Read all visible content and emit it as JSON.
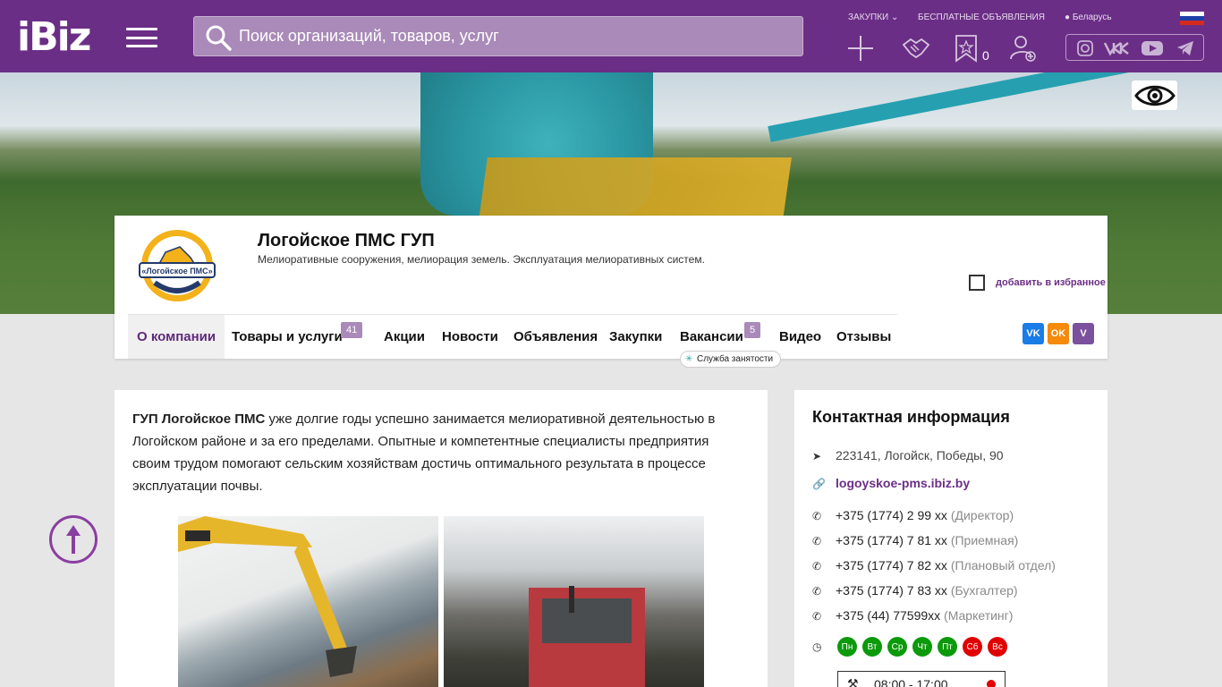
{
  "header": {
    "logo_text": "iBiz",
    "search_placeholder": "Поиск организаций, товаров, услуг",
    "links": {
      "purchases": "ЗАКУПКИ",
      "free_ads": "БЕСПЛАТНЫЕ ОБЪЯВЛЕНИЯ",
      "region": "Беларусь"
    },
    "favorites_count": "0",
    "brand_color": "#6b2e86"
  },
  "company": {
    "name": "Логойское ПМС ГУП",
    "description": "Мелиоративные сооружения, мелиорация земель. Эксплуатация мелиоративных систем.",
    "add_favorite": "добавить в избранное",
    "logo_text": "«Логойское ПМС»"
  },
  "tabs": [
    {
      "label": "О компании"
    },
    {
      "label": "Товары и услуги",
      "badge": "41"
    },
    {
      "label": "Акции"
    },
    {
      "label": "Новости"
    },
    {
      "label": "Объявления"
    },
    {
      "label": "Закупки"
    },
    {
      "label": "Вакансии",
      "badge": "5"
    },
    {
      "label": "Видео"
    },
    {
      "label": "Отзывы"
    }
  ],
  "employment_tip": "Служба занятости",
  "share": {
    "vk": "VK",
    "ok": "OK",
    "viber": "V"
  },
  "about": {
    "lead": "ГУП Логойское ПМС",
    "text": " уже долгие годы успешно занимается мелиоративной деятельностью в Логойском районе и за его пределами. Опытные и компетентные специалисты предприятия своим трудом помогают сельским хозяйствам достичь оптимального результата в процессе эксплуатации почвы."
  },
  "contacts": {
    "title": "Контактная информация",
    "address": "223141, Логойск, Победы, 90",
    "site": "logoyskoe-pms.ibiz.by",
    "phones": [
      {
        "number": "+375 (1774) 2 99 xx",
        "note": "(Директор)"
      },
      {
        "number": "+375 (1774) 7 81 xx",
        "note": "(Приемная)"
      },
      {
        "number": "+375 (1774) 7 82 xx",
        "note": "(Плановый отдел)"
      },
      {
        "number": "+375 (1774) 7 83 xx",
        "note": "(Бухгалтер)"
      },
      {
        "number": "+375 (44) 77599xx",
        "note": "(Маркетинг)"
      }
    ],
    "days": [
      "Пн",
      "Вт",
      "Ср",
      "Чт",
      "Пт",
      "Сб",
      "Вс"
    ],
    "hours": "08:00 - 17:00"
  }
}
